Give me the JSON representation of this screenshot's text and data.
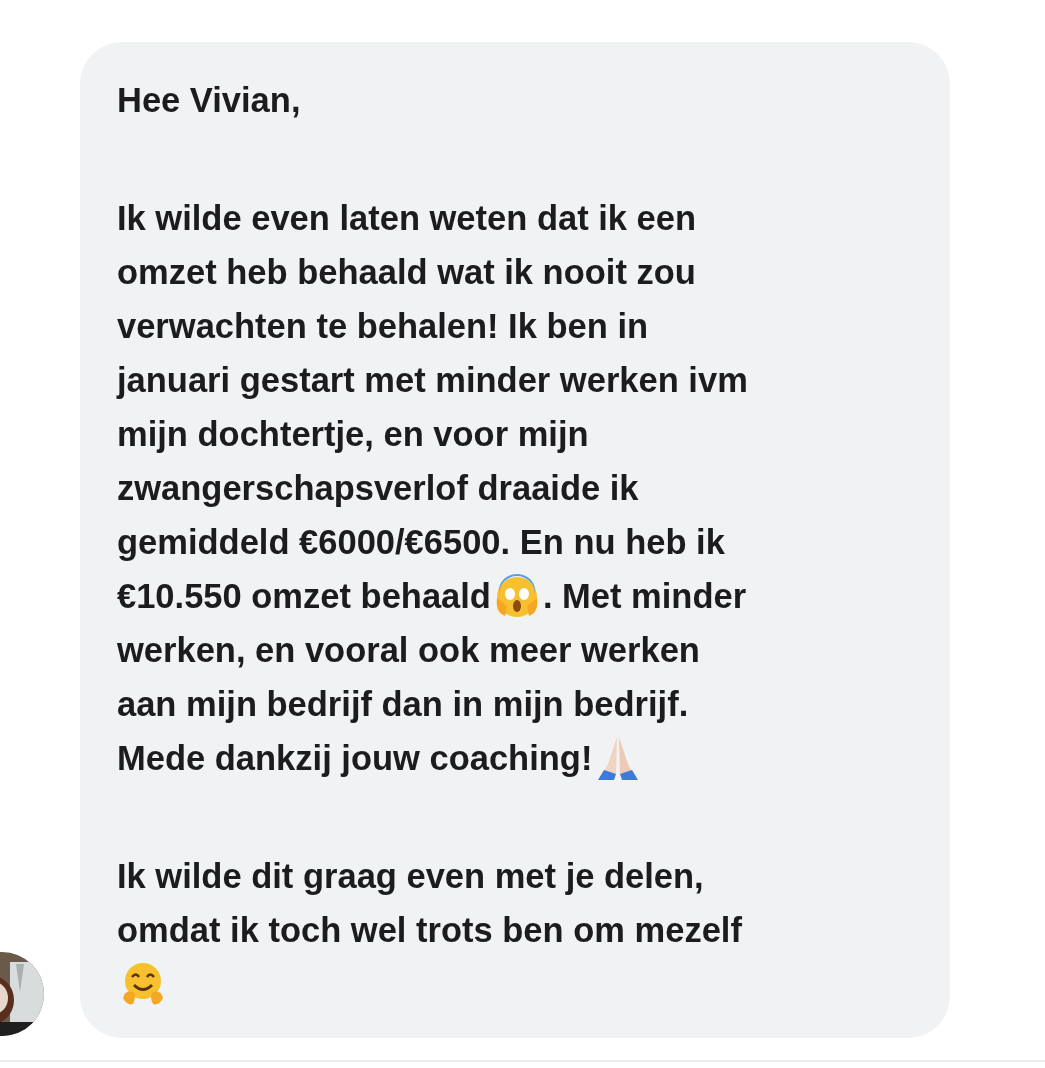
{
  "message": {
    "paragraphs": [
      {
        "lines": [
          [
            {
              "kind": "text",
              "text": "Hee Vivian,"
            }
          ]
        ]
      },
      {
        "lines": [
          [
            {
              "kind": "text",
              "text": "Ik wilde even laten weten dat ik een"
            }
          ],
          [
            {
              "kind": "text",
              "text": "omzet heb behaald wat ik nooit zou"
            }
          ],
          [
            {
              "kind": "text",
              "text": "verwachten te behalen! Ik ben in"
            }
          ],
          [
            {
              "kind": "text",
              "text": "januari gestart met minder werken ivm"
            }
          ],
          [
            {
              "kind": "text",
              "text": "mijn dochtertje, en voor mijn"
            }
          ],
          [
            {
              "kind": "text",
              "text": "zwangerschapsverlof draaide ik"
            }
          ],
          [
            {
              "kind": "text",
              "text": "gemiddeld €6000/€6500. En nu heb ik"
            }
          ],
          [
            {
              "kind": "text",
              "text": "€10.550 omzet behaald"
            },
            {
              "kind": "scream"
            },
            {
              "kind": "text",
              "text": ". Met minder"
            }
          ],
          [
            {
              "kind": "text",
              "text": "werken, en vooral ook meer werken"
            }
          ],
          [
            {
              "kind": "text",
              "text": "aan mijn bedrijf dan in mijn bedrijf."
            }
          ],
          [
            {
              "kind": "text",
              "text": "Mede dankzij jouw coaching!"
            },
            {
              "kind": "pray"
            }
          ]
        ]
      },
      {
        "lines": [
          [
            {
              "kind": "text",
              "text": "Ik wilde dit graag even met je delen,"
            }
          ],
          [
            {
              "kind": "text",
              "text": "omdat ik toch wel trots ben om mezelf"
            }
          ],
          [
            {
              "kind": "hug"
            }
          ]
        ]
      }
    ]
  }
}
